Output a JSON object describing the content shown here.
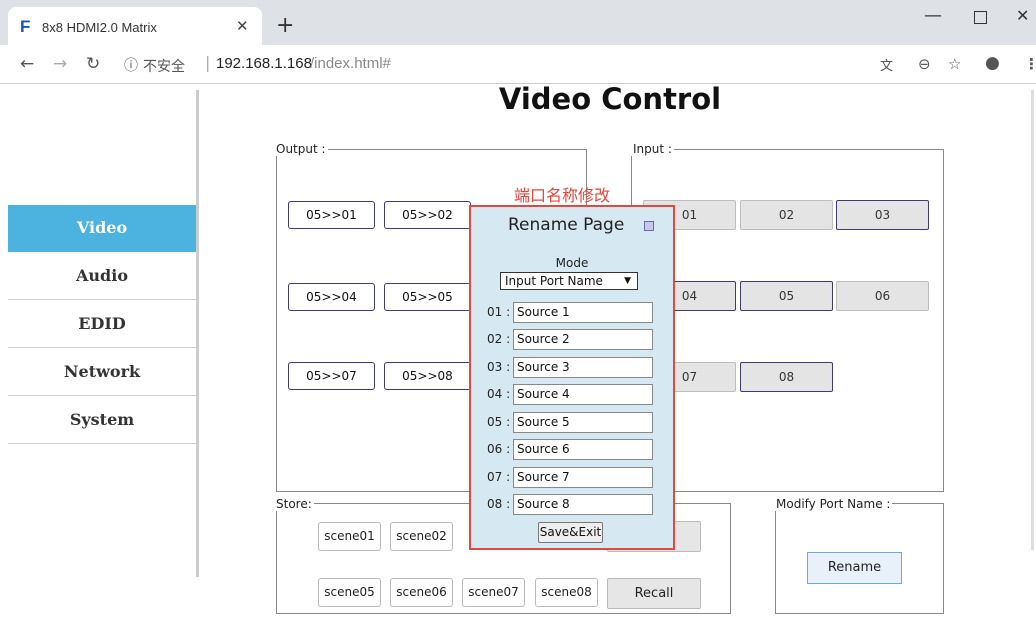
{
  "browser": {
    "tab_icon": "F",
    "tab_title": "8x8 HDMI2.0 Matrix",
    "tab_close": "✕",
    "new_tab": "+",
    "url_security": "不安全",
    "url_host": "192.168.1.168",
    "url_path": "/index.html#",
    "icons": [
      "back-icon",
      "forward-icon",
      "reload-icon",
      "info-icon",
      "translate-icon",
      "zoom-icon",
      "star-icon",
      "profile-icon",
      "menu-icon"
    ]
  },
  "sidebar": {
    "items": [
      {
        "label": "Video",
        "active": true
      },
      {
        "label": "Audio",
        "active": false
      },
      {
        "label": "EDID",
        "active": false
      },
      {
        "label": "Network",
        "active": false
      },
      {
        "label": "System",
        "active": false
      }
    ]
  },
  "page": {
    "title": "Video Control"
  },
  "output": {
    "legend": "Output :",
    "buttons": [
      "05>>01",
      "05>>02",
      "05>>04",
      "05>>05",
      "05>>07",
      "05>>08"
    ]
  },
  "input": {
    "legend": "Input :",
    "buttons": [
      "01",
      "02",
      "03",
      "04",
      "05",
      "06",
      "07",
      "08"
    ]
  },
  "store": {
    "legend": "Store:",
    "scenes": [
      "scene01",
      "scene02",
      "scene05",
      "scene06",
      "scene07",
      "scene08"
    ],
    "recall_label": "Recall"
  },
  "modify": {
    "legend": "Modify Port Name :",
    "rename_label": "Rename"
  },
  "popup": {
    "annotation": "端口名称修改",
    "title": "Rename Page",
    "mode_label": "Mode",
    "mode_value": "Input Port Name",
    "rows": [
      {
        "num": "01 :",
        "value": "Source 1"
      },
      {
        "num": "02 :",
        "value": "Source 2"
      },
      {
        "num": "03 :",
        "value": "Source 3"
      },
      {
        "num": "04 :",
        "value": "Source 4"
      },
      {
        "num": "05 :",
        "value": "Source 5"
      },
      {
        "num": "06 :",
        "value": "Source 6"
      },
      {
        "num": "07 :",
        "value": "Source 7"
      },
      {
        "num": "08 :",
        "value": "Source 8"
      }
    ],
    "save_label": "Save&Exit"
  },
  "colors": {
    "active_nav": "#4cb2e0",
    "annotation": "#e8453c",
    "popup_bg": "#d6e8f2"
  }
}
